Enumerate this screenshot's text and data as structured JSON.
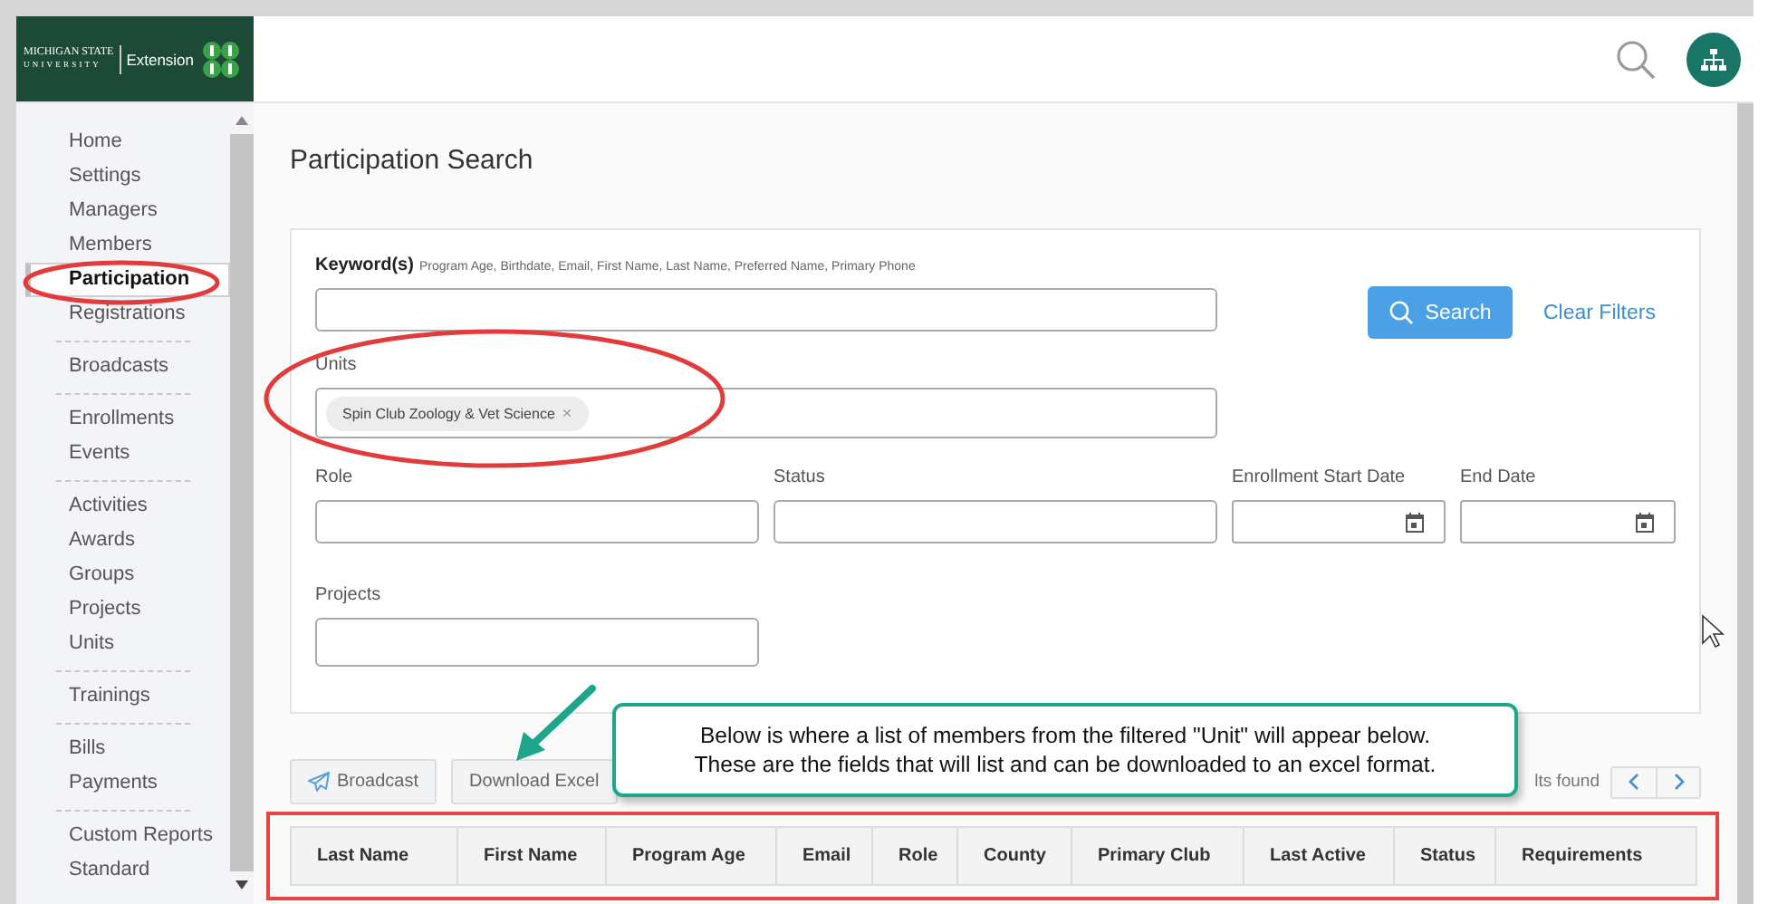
{
  "logo": {
    "line_1": "MICHIGAN STATE",
    "line_2": "UNIVERSITY",
    "name": "Extension"
  },
  "sidebar": {
    "groups": [
      {
        "items": [
          {
            "label": "Home",
            "selected": false
          },
          {
            "label": "Settings",
            "selected": false
          },
          {
            "label": "Managers",
            "selected": false
          },
          {
            "label": "Members",
            "selected": false
          },
          {
            "label": "Participation",
            "selected": true
          },
          {
            "label": "Registrations",
            "selected": false
          }
        ]
      },
      {
        "items": [
          {
            "label": "Broadcasts",
            "selected": false
          }
        ]
      },
      {
        "items": [
          {
            "label": "Enrollments",
            "selected": false
          },
          {
            "label": "Events",
            "selected": false
          }
        ]
      },
      {
        "items": [
          {
            "label": "Activities",
            "selected": false
          },
          {
            "label": "Awards",
            "selected": false
          },
          {
            "label": "Groups",
            "selected": false
          },
          {
            "label": "Projects",
            "selected": false
          },
          {
            "label": "Units",
            "selected": false
          }
        ]
      },
      {
        "items": [
          {
            "label": "Trainings",
            "selected": false
          }
        ]
      },
      {
        "items": [
          {
            "label": "Bills",
            "selected": false
          },
          {
            "label": "Payments",
            "selected": false
          }
        ]
      },
      {
        "items": [
          {
            "label": "Custom Reports",
            "selected": false
          },
          {
            "label": "Standard",
            "selected": false
          }
        ]
      }
    ]
  },
  "page_title": "Participation Search",
  "filters": {
    "keyword": {
      "label": "Keyword(s)",
      "hint": "Program Age, Birthdate, Email, First Name, Last Name, Preferred Name, Primary Phone"
    },
    "search_button": "Search",
    "clear_filters": "Clear Filters",
    "units": {
      "label": "Units",
      "chips": [
        {
          "label": "Spin Club Zoology & Vet Science",
          "remove": "×"
        }
      ]
    },
    "fields": [
      {
        "label": "Role",
        "kind": "text"
      },
      {
        "label": "Status",
        "kind": "text"
      },
      {
        "label": "Enrollment Start Date",
        "kind": "date"
      },
      {
        "label": "End Date",
        "kind": "date"
      }
    ],
    "projects": {
      "label": "Projects"
    }
  },
  "toolbar": {
    "buttons": [
      {
        "label": "Broadcast",
        "kind": "icon"
      },
      {
        "label": "Download Excel",
        "kind": "plain"
      }
    ],
    "results_text": "lts found"
  },
  "table": {
    "columns": [
      "Last Name",
      "First Name",
      "Program Age",
      "Email",
      "Role",
      "County",
      "Primary Club",
      "Last Active",
      "Status",
      "Requirements"
    ]
  },
  "annotation": {
    "callout": [
      "Below is where a list of members from the filtered \"Unit\" will appear below.",
      "These are the fields that will list and can be downloaded to an excel format."
    ]
  }
}
